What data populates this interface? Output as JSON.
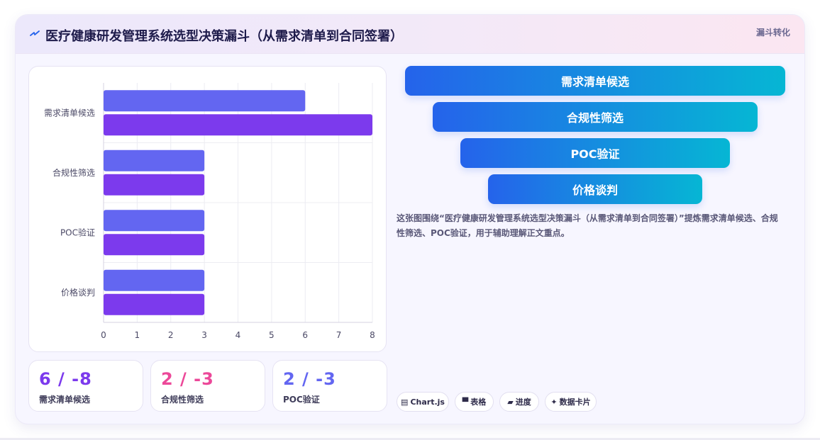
{
  "header": {
    "title": "医疗健康研发管理系统选型决策漏斗（从需求清单到合同签署）",
    "tag": "漏斗转化"
  },
  "chart_data": {
    "type": "bar",
    "orientation": "horizontal",
    "categories": [
      "需求清单候选",
      "合规性筛选",
      "POC验证",
      "价格谈判"
    ],
    "series": [
      {
        "values": [
          6,
          3,
          3,
          3
        ],
        "color": "#6366f1"
      },
      {
        "values": [
          8,
          3,
          3,
          3
        ],
        "color": "#7c3aed"
      }
    ],
    "xlim": [
      0,
      8
    ],
    "xticks": [
      "0",
      "1",
      "2",
      "3",
      "4",
      "5",
      "6",
      "7",
      "8"
    ],
    "grid": true
  },
  "stats": [
    {
      "value": "6 / -8",
      "label": "需求清单候选",
      "color": "#7c3aed"
    },
    {
      "value": "2 / -3",
      "label": "合规性筛选",
      "color": "#ec4899"
    },
    {
      "value": "2 / -3",
      "label": "POC验证",
      "color": "#6366f1"
    }
  ],
  "funnel": {
    "steps": [
      "需求清单候选",
      "合规性筛选",
      "POC验证",
      "价格谈判"
    ]
  },
  "description": "这张图围绕“医疗健康研发管理系统选型决策漏斗（从需求清单到合同签署）”提炼需求清单候选、合规性筛选、POC验证，用于辅助理解正文重点。",
  "chips": [
    {
      "icon": "▤",
      "label": "Chart.js",
      "icon_name": "chart-icon"
    },
    {
      "icon": "▀",
      "label": "表格",
      "icon_name": "table-icon"
    },
    {
      "icon": "▰",
      "label": "进度",
      "icon_name": "progress-icon"
    },
    {
      "icon": "✦",
      "label": "数据卡片",
      "icon_name": "sparkle-icon"
    }
  ]
}
